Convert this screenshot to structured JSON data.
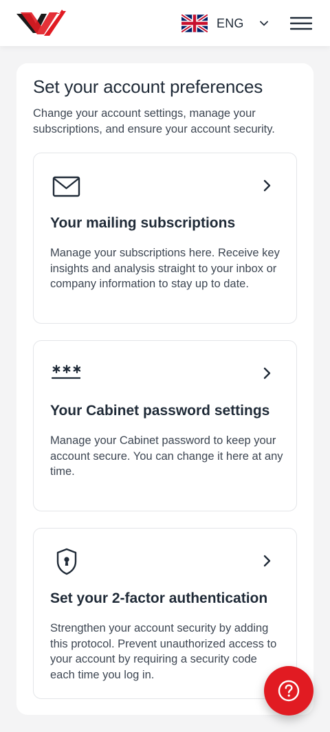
{
  "header": {
    "logo_icon": "brand-logo",
    "language": {
      "label": "ENG",
      "flag_icon": "uk-flag-icon",
      "chevron_icon": "chevron-down-icon"
    },
    "menu_icon": "hamburger-menu-icon"
  },
  "main": {
    "title": "Set your account preferences",
    "subtitle": "Change your account settings, manage your subscriptions, and ensure your account security.",
    "cards": [
      {
        "icon": "mail-icon",
        "title": "Your mailing subscriptions",
        "description": "Manage your subscriptions here. Receive key insights and analysis straight to your inbox or company information to stay up to date."
      },
      {
        "icon": "password-icon",
        "title": "Your Cabinet password settings",
        "description": "Manage your Cabinet password to keep your account secure. You can change it here at any time."
      },
      {
        "icon": "shield-lock-icon",
        "title": "Set your 2-factor authentication",
        "description": "Strengthen your account security by adding this protocol. Prevent unauthorized access to your account by requiring a security code each time you log in."
      }
    ]
  },
  "help_button": {
    "icon": "question-mark-icon"
  },
  "colors": {
    "accent": "#e11b22",
    "text": "#1f2a37",
    "background": "#f4f4f5",
    "card_border": "#e3e5e8"
  }
}
